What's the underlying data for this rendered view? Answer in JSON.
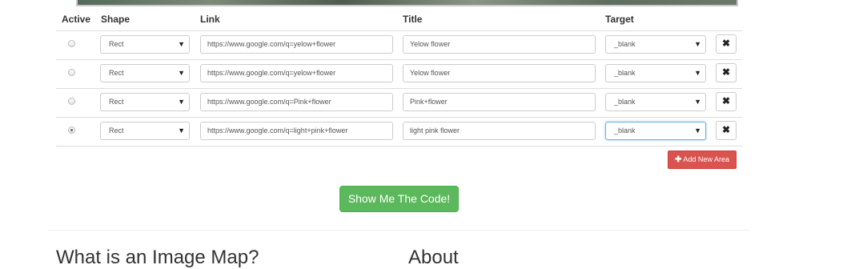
{
  "table": {
    "headers": {
      "active": "Active",
      "shape": "Shape",
      "link": "Link",
      "title": "Title",
      "target": "Target"
    },
    "rows": [
      {
        "active": false,
        "shape": "Rect",
        "link": "https://www.google.com/q=yelow+flower",
        "title": "Yelow flower",
        "target": "_blank"
      },
      {
        "active": false,
        "shape": "Rect",
        "link": "https://www.google.com/q=yelow+flower",
        "title": "Yelow flower",
        "target": "_blank"
      },
      {
        "active": false,
        "shape": "Rect",
        "link": "https://www.google.com/q=Pink+flower",
        "title": "Pink+flower",
        "target": "_blank"
      },
      {
        "active": true,
        "shape": "Rect",
        "link": "https://www.google.com/q=light+pink+flower",
        "title": "light pink flower",
        "target": "_blank"
      }
    ],
    "remove_label": "✖",
    "dropdown_arrow": "▼"
  },
  "actions": {
    "add_label": "Add New Area",
    "add_icon": "plus-icon",
    "show_code_label": "Show Me The Code!"
  },
  "sections": {
    "left_heading": "What is an Image Map?",
    "right_heading": "About"
  },
  "colors": {
    "add_button": "#d9534f",
    "show_button": "#5cb85c",
    "focus_border": "#66afe9"
  }
}
